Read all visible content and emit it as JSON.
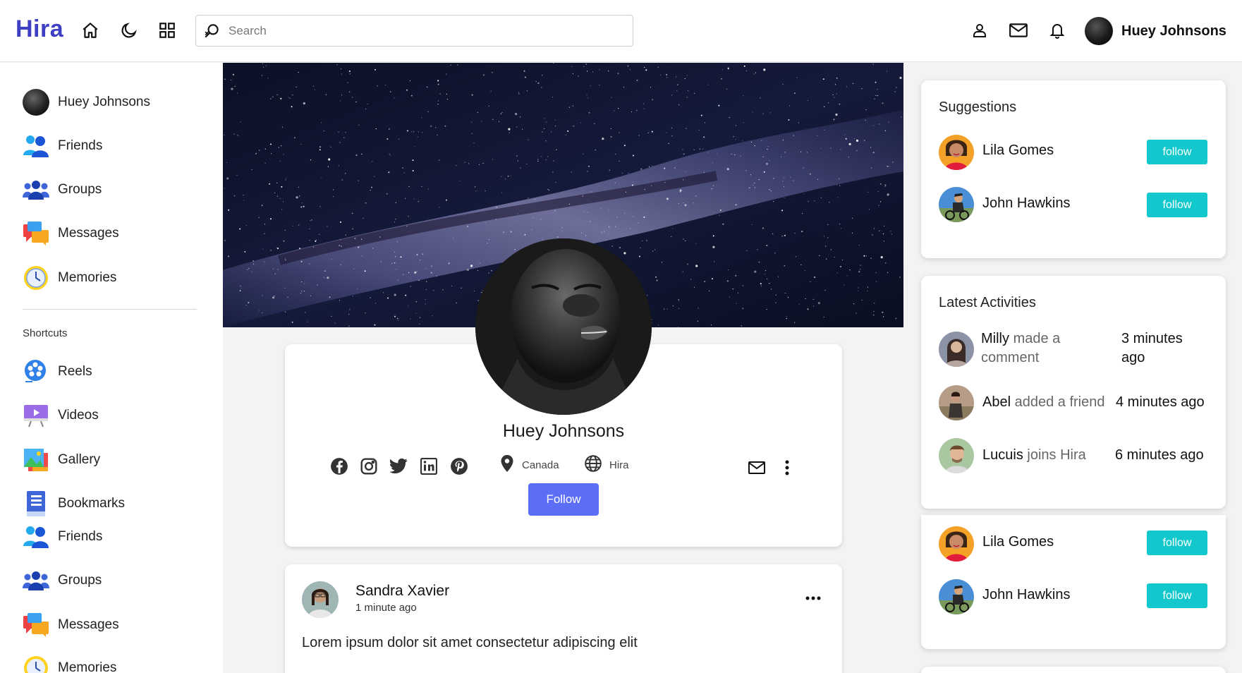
{
  "app": {
    "logo": "Hira"
  },
  "header": {
    "search_placeholder": "Search",
    "user_name": "Huey Johnsons"
  },
  "sidebar": {
    "profile_name": "Huey Johnsons",
    "items": [
      {
        "label": "Friends"
      },
      {
        "label": "Groups"
      },
      {
        "label": "Messages"
      },
      {
        "label": "Memories"
      }
    ],
    "shortcuts_heading": "Shortcuts",
    "shortcuts": [
      {
        "label": "Reels"
      },
      {
        "label": "Videos"
      },
      {
        "label": "Gallery"
      },
      {
        "label": "Bookmarks"
      },
      {
        "label": "Friends"
      },
      {
        "label": "Groups"
      },
      {
        "label": "Messages"
      },
      {
        "label": "Memories"
      }
    ]
  },
  "profile": {
    "name": "Huey Johnsons",
    "location": "Canada",
    "website": "Hira",
    "follow_label": "Follow"
  },
  "post": {
    "author": "Sandra Xavier",
    "time": "1 minute ago",
    "text": "Lorem ipsum dolor sit amet consectetur adipiscing elit"
  },
  "suggestions": {
    "title": "Suggestions",
    "people": [
      {
        "name": "Lila Gomes",
        "button": "follow"
      },
      {
        "name": "John Hawkins",
        "button": "follow"
      }
    ]
  },
  "activities": {
    "title": "Latest Activities",
    "items": [
      {
        "name": "Milly",
        "action": "made a comment",
        "time": "3 minutes ago"
      },
      {
        "name": "Abel",
        "action": "added a friend",
        "time": "4 minutes ago"
      },
      {
        "name": "Lucuis",
        "action": "joins Hira",
        "time": "6 minutes ago"
      }
    ]
  },
  "suggestions2": {
    "people": [
      {
        "name": "Lila Gomes",
        "button": "follow"
      },
      {
        "name": "John Hawkins",
        "button": "follow"
      }
    ]
  },
  "colors": {
    "brand": "#3f3fc4",
    "primary_button": "#5b6ef5",
    "follow_button": "#12c8cc"
  }
}
